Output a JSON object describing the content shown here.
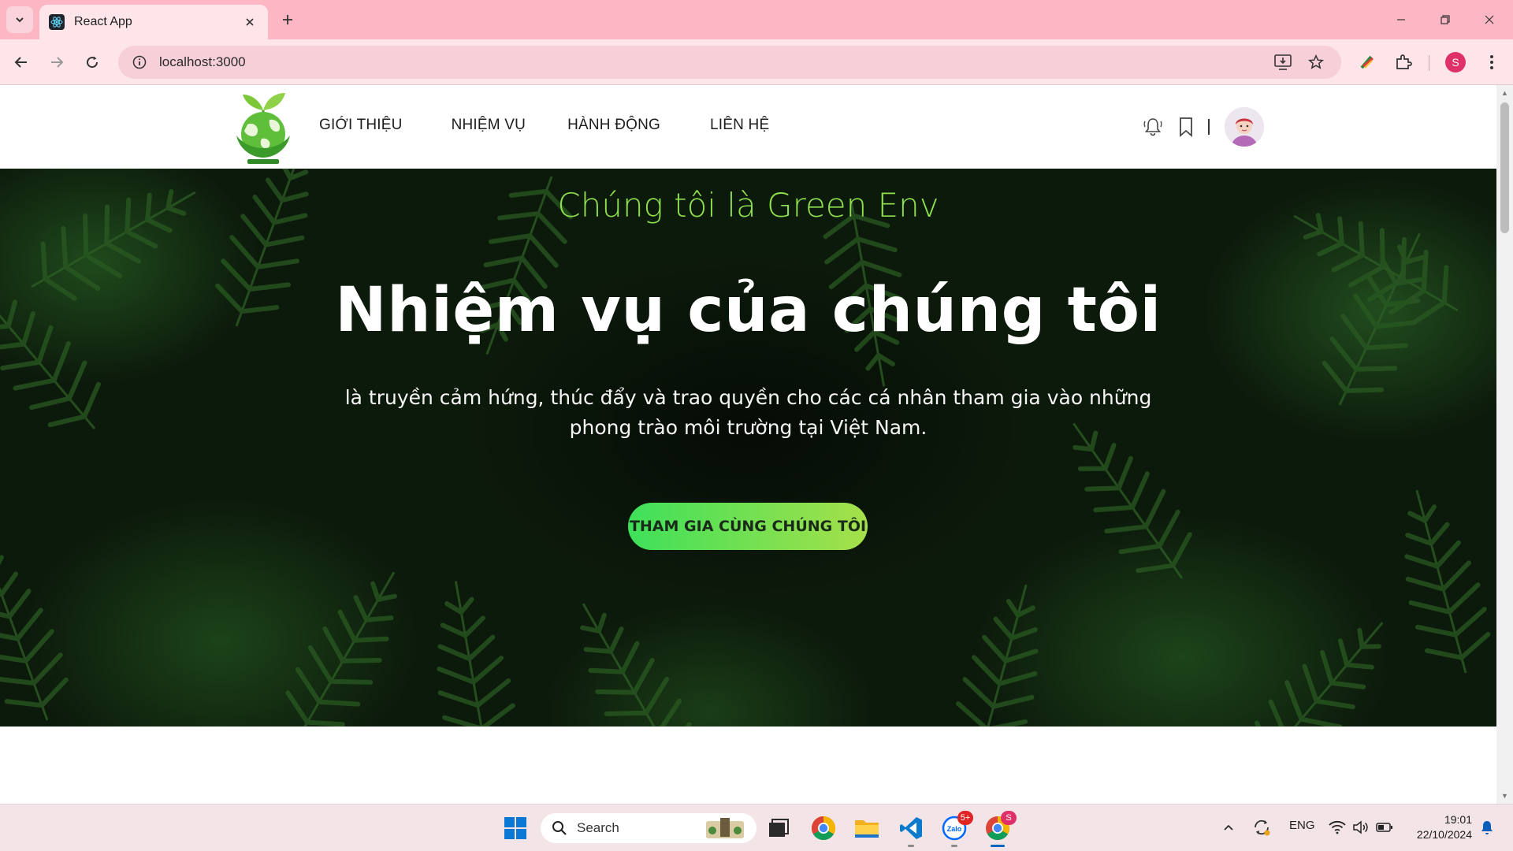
{
  "browser": {
    "tab_title": "React App",
    "url": "localhost:3000",
    "profile_initial": "S",
    "icons": {
      "tab_search": "chevron-down-icon",
      "tab_close": "close-icon",
      "new_tab": "plus-icon",
      "back": "arrow-left-icon",
      "forward": "arrow-right-icon",
      "reload": "reload-icon",
      "site_info": "info-icon",
      "install": "install-icon",
      "bookmark": "star-icon",
      "extension_color": "color-extension-icon",
      "extensions": "puzzle-icon",
      "menu": "kebab-icon",
      "minimize": "minimize-icon",
      "restore": "restore-icon",
      "close": "close-icon"
    }
  },
  "site": {
    "nav": [
      "GIỚI THIỆU",
      "NHIỆM VỤ",
      "HÀNH ĐỘNG",
      "LIÊN HỆ"
    ],
    "header_icons": [
      "bell-icon",
      "bookmark-icon"
    ],
    "hero": {
      "subtitle": "Chúng tôi là Green Env",
      "title": "Nhiệm vụ của chúng tôi",
      "description": "là truyền cảm hứng, thúc đẩy và trao quyền cho các cá nhân tham gia vào những phong trào môi trường tại Việt Nam.",
      "cta": "THAM GIA CÙNG CHÚNG TÔI"
    },
    "colors": {
      "subtitle": "#8ee04e",
      "cta_start": "#3ee05a",
      "cta_end": "#a6e04a",
      "hero_bg": "#0c1a0b"
    }
  },
  "taskbar": {
    "search_label": "Search",
    "apps": [
      "windows-start-icon",
      "task-view-icon",
      "chrome-icon",
      "file-explorer-icon",
      "vscode-icon",
      "zalo-icon",
      "chrome-profile-icon"
    ],
    "zalo_badge": "5+",
    "chrome_badge": "S",
    "tray": {
      "language": "ENG",
      "time": "19:01",
      "date": "22/10/2024"
    }
  }
}
